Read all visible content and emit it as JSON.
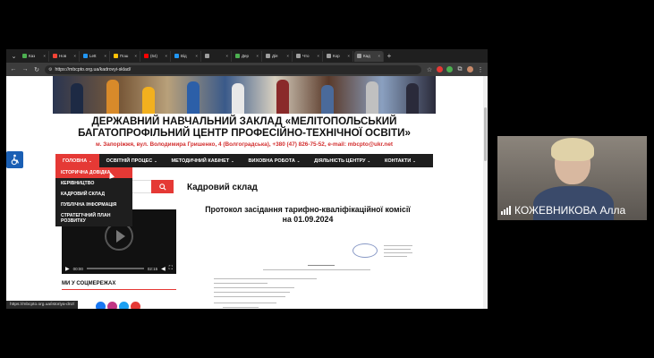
{
  "browser": {
    "tabs": [
      {
        "label": "Каз",
        "color": "#4caf50"
      },
      {
        "label": "Нов",
        "color": "#f44336"
      },
      {
        "label": "Lett",
        "color": "#2196f3"
      },
      {
        "label": "Пош",
        "color": "#ffc107"
      },
      {
        "label": "(64)",
        "color": "#ff0000"
      },
      {
        "label": "Від",
        "color": "#2196f3"
      },
      {
        "label": "",
        "color": "#9e9e9e"
      },
      {
        "label": "Дер",
        "color": "#4caf50"
      },
      {
        "label": "Дія",
        "color": "#9e9e9e"
      },
      {
        "label": "Что",
        "color": "#9e9e9e"
      },
      {
        "label": "Кор",
        "color": "#9e9e9e"
      },
      {
        "label": "Кад",
        "color": "#9e9e9e",
        "active": true
      }
    ],
    "url": "https://mbcpto.org.ua/kadrovyi-sklad/",
    "status_url": "https://mbcpto.org.ua/istoriya-dnz/"
  },
  "site": {
    "title_line1": "ДЕРЖАВНИЙ НАВЧАЛЬНИЙ ЗАКЛАД «МЕЛІТОПОЛЬСЬКИЙ",
    "title_line2": "БАГАТОПРОФІЛЬНИЙ ЦЕНТР ПРОФЕСІЙНО-ТЕХНІЧНОЇ ОСВІТИ»",
    "address": "м. Запоріжжя, вул. Володимира Гришенко, 4 (Волгоградська), +380 (47) 826-75-52, e-mail: mbcpto@ukr.net",
    "nav": [
      {
        "label": "ГОЛОВНА",
        "active": true
      },
      {
        "label": "ОСВІТНІЙ ПРОЦЕС"
      },
      {
        "label": "МЕТОДИЧНИЙ КАБІНЕТ"
      },
      {
        "label": "ВИХОВНА РОБОТА"
      },
      {
        "label": "ДІЯЛЬНІСТЬ ЦЕНТРУ"
      },
      {
        "label": "КОНТАКТИ"
      }
    ],
    "dropdown": [
      {
        "label": "ІСТОРИЧНА ДОВІДКА",
        "active": true
      },
      {
        "label": "КЕРІВНИЦТВО"
      },
      {
        "label": "КАДРОВИЙ СКЛАД"
      },
      {
        "label": "ПУБЛІЧНА ІНФОРМАЦІЯ"
      },
      {
        "label": "СТРАТЕГІЧНИЙ ПЛАН РОЗВИТКУ"
      }
    ],
    "player": {
      "current": "00:00",
      "duration": "02:15"
    },
    "social_title": "МИ У СОЦМЕРЕЖАХ",
    "main_title": "Кадровий склад",
    "doc_title_line1": "Протокол засідання тарифно-кваліфікаційної комісії",
    "doc_title_line2": "на 01.09.2024"
  },
  "video": {
    "name": "КОЖЕВНИКОВА Алла"
  }
}
